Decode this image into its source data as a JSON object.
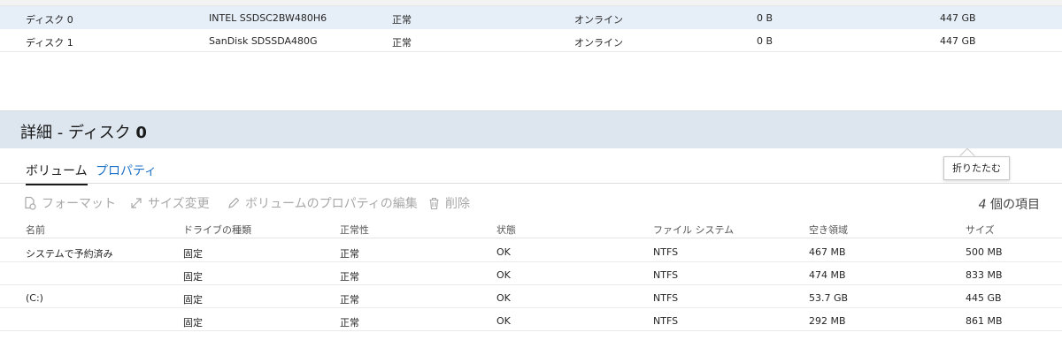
{
  "disks": [
    {
      "name": "ディスク 0",
      "model": "INTEL SSDSC2BW480H6",
      "health": "正常",
      "status": "オンライン",
      "unallocated": "0 B",
      "size": "447 GB",
      "selected": true
    },
    {
      "name": "ディスク 1",
      "model": "SanDisk SDSSDA480G",
      "health": "正常",
      "status": "オンライン",
      "unallocated": "0 B",
      "size": "447 GB",
      "selected": false
    }
  ],
  "details": {
    "title_prefix": "詳細 - ディスク ",
    "title_number": "0",
    "collapse_tooltip": "折りたたむ"
  },
  "tabs": [
    {
      "label": "ボリューム",
      "active": true
    },
    {
      "label": "プロパティ",
      "active": false
    }
  ],
  "toolbar": {
    "format_label": "フォーマット",
    "resize_label": "サイズ変更",
    "edit_props_label": "ボリュームのプロパティの編集",
    "delete_label": "削除",
    "item_count_number": "4",
    "item_count_suffix": " 個の項目"
  },
  "volumes": {
    "headers": [
      "名前",
      "ドライブの種類",
      "正常性",
      "状態",
      "ファイル システム",
      "空き領域",
      "サイズ"
    ],
    "rows": [
      [
        "システムで予約済み",
        "固定",
        "正常",
        "OK",
        "NTFS",
        "467 MB",
        "500 MB"
      ],
      [
        "",
        "固定",
        "正常",
        "OK",
        "NTFS",
        "474 MB",
        "833 MB"
      ],
      [
        "(C:)",
        "固定",
        "正常",
        "OK",
        "NTFS",
        "53.7 GB",
        "445 GB"
      ],
      [
        "",
        "固定",
        "正常",
        "OK",
        "NTFS",
        "292 MB",
        "861 MB"
      ]
    ]
  },
  "colors": {
    "selected_row": "#e6eef7",
    "details_header": "#dde6ef",
    "link_blue": "#1f73c7",
    "disabled_text": "#a8a8a8"
  },
  "icons": {
    "format": "format-icon",
    "resize": "resize-icon",
    "edit": "pencil-icon",
    "delete": "trash-icon"
  }
}
